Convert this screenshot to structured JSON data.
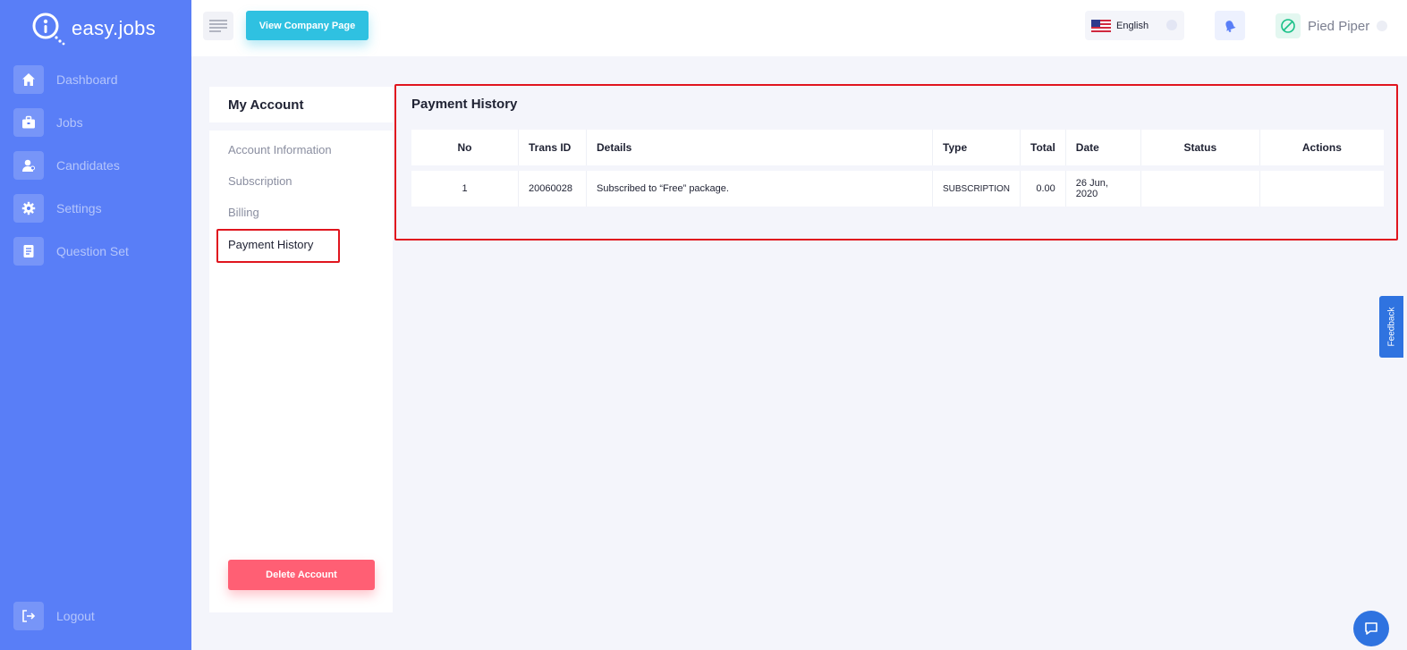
{
  "app": {
    "name": "easy.jobs"
  },
  "sidebar": {
    "items": [
      {
        "label": "Dashboard",
        "icon": "home-icon"
      },
      {
        "label": "Jobs",
        "icon": "briefcase-icon"
      },
      {
        "label": "Candidates",
        "icon": "user-icon"
      },
      {
        "label": "Settings",
        "icon": "gear-icon"
      },
      {
        "label": "Question Set",
        "icon": "document-icon"
      }
    ],
    "logout_label": "Logout"
  },
  "header": {
    "view_company_label": "View Company Page",
    "language": "English",
    "company_name": "Pied Piper"
  },
  "account": {
    "title": "My Account",
    "menu": [
      "Account Information",
      "Subscription",
      "Billing",
      "Payment History"
    ],
    "active": "Payment History",
    "delete_label": "Delete Account"
  },
  "payment_history": {
    "title": "Payment History",
    "columns": [
      "No",
      "Trans ID",
      "Details",
      "Type",
      "Total",
      "Date",
      "Status",
      "Actions"
    ],
    "rows": [
      {
        "no": "1",
        "trans_id": "20060028",
        "details": "Subscribed to “Free” package.",
        "type": "SUBSCRIPTION",
        "total": "0.00",
        "date": "26 Jun, 2020",
        "status": "",
        "actions": ""
      }
    ]
  },
  "feedback_label": "Feedback",
  "colors": {
    "sidebar": "#597ef7",
    "accent": "#2fc1e1",
    "danger": "#ff5f74",
    "highlight": "#e0151e"
  }
}
